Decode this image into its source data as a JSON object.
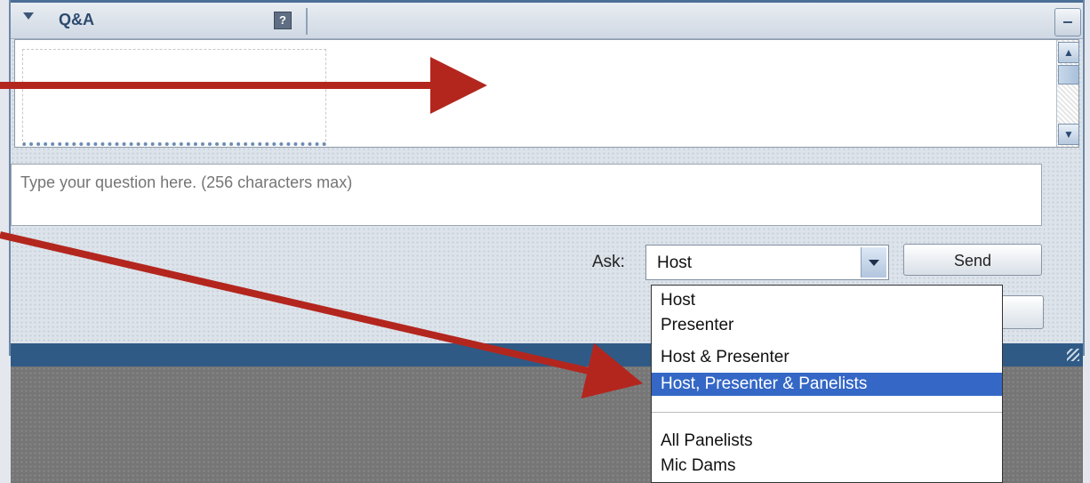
{
  "panel": {
    "title": "Q&A",
    "help_icon_text": "?"
  },
  "question_input": {
    "placeholder": "Type your question here. (256 characters max)"
  },
  "ask": {
    "label": "Ask:",
    "selected": "Host",
    "send_label": "Send",
    "options": [
      {
        "label": "Host"
      },
      {
        "label": "Presenter"
      },
      {
        "label": "Host & Presenter"
      },
      {
        "label": "Host, Presenter & Panelists",
        "highlighted": true
      },
      {
        "label": ""
      },
      {
        "label": "All Panelists"
      },
      {
        "label": "Mic Dams"
      }
    ]
  },
  "colors": {
    "title_bar": "#4b6e96",
    "bottom_bar": "#2f5a85",
    "selection": "#3467c6",
    "annotation_arrow": "#b3261e"
  },
  "icons": [
    "collapse-triangle-icon",
    "help-icon",
    "minimize-icon",
    "scroll-up-icon",
    "scroll-down-icon",
    "dropdown-arrow-icon",
    "resize-grip-icon",
    "annotation-arrow"
  ]
}
